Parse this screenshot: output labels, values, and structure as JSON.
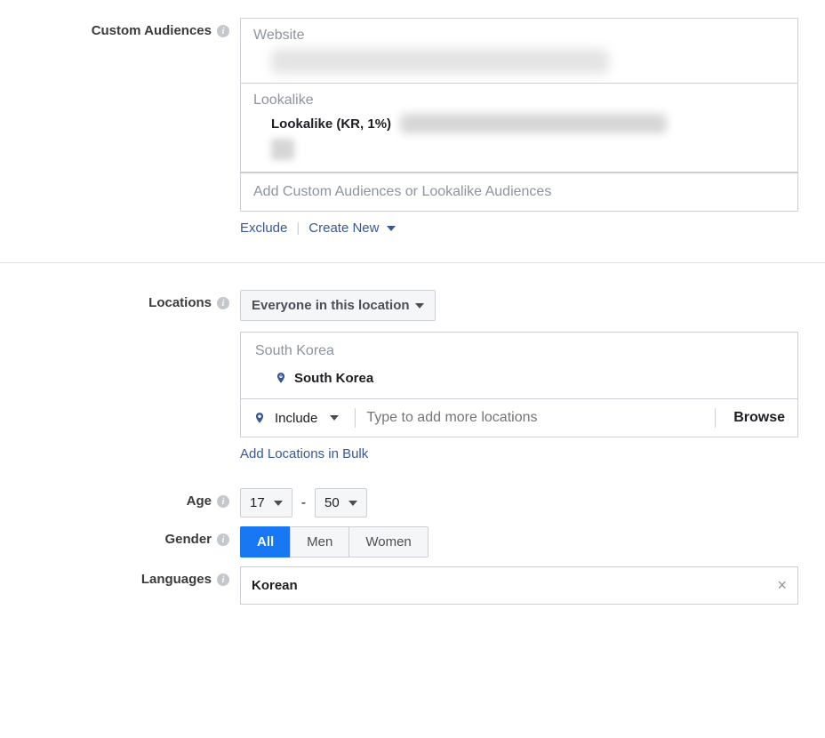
{
  "custom_audiences": {
    "label": "Custom Audiences",
    "website_head": "Website",
    "lookalike_head": "Lookalike",
    "lookalike_name": "Lookalike (KR, 1%)",
    "input_placeholder": "Add Custom Audiences or Lookalike Audiences",
    "exclude_link": "Exclude",
    "create_new_link": "Create New"
  },
  "locations": {
    "label": "Locations",
    "scope": "Everyone in this location",
    "country_group": "South Korea",
    "selected_location": "South Korea",
    "include_label": "Include",
    "input_placeholder": "Type to add more locations",
    "browse_label": "Browse",
    "bulk_link": "Add Locations in Bulk"
  },
  "age": {
    "label": "Age",
    "min": "17",
    "max": "50"
  },
  "gender": {
    "label": "Gender",
    "options": [
      "All",
      "Men",
      "Women"
    ],
    "selected": "All"
  },
  "languages": {
    "label": "Languages",
    "selected": "Korean"
  }
}
